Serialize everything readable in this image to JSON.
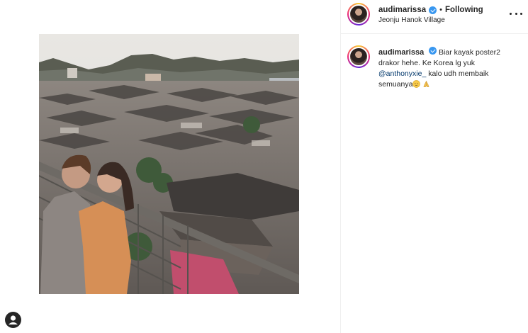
{
  "post": {
    "username": "audimarissa",
    "follow_status": "Following",
    "separator": "•",
    "location": "Jeonju Hanok Village",
    "caption": {
      "username": "audimarissa",
      "text_before": "Biar kayak poster2 drakor hehe. Ke Korea lg yuk",
      "mention": "@anthonyxie_",
      "text_after": "kalo udh membaik semuanya"
    }
  },
  "icons": {
    "verified": "verified-badge-icon",
    "more": "more-options-icon",
    "pensive_emoji": "pensive-face-emoji",
    "pray_emoji": "folded-hands-emoji",
    "profile": "profile-icon"
  },
  "colors": {
    "link": "#00376b",
    "verified": "#3897f0",
    "text": "#262626",
    "divider": "#efefef"
  }
}
